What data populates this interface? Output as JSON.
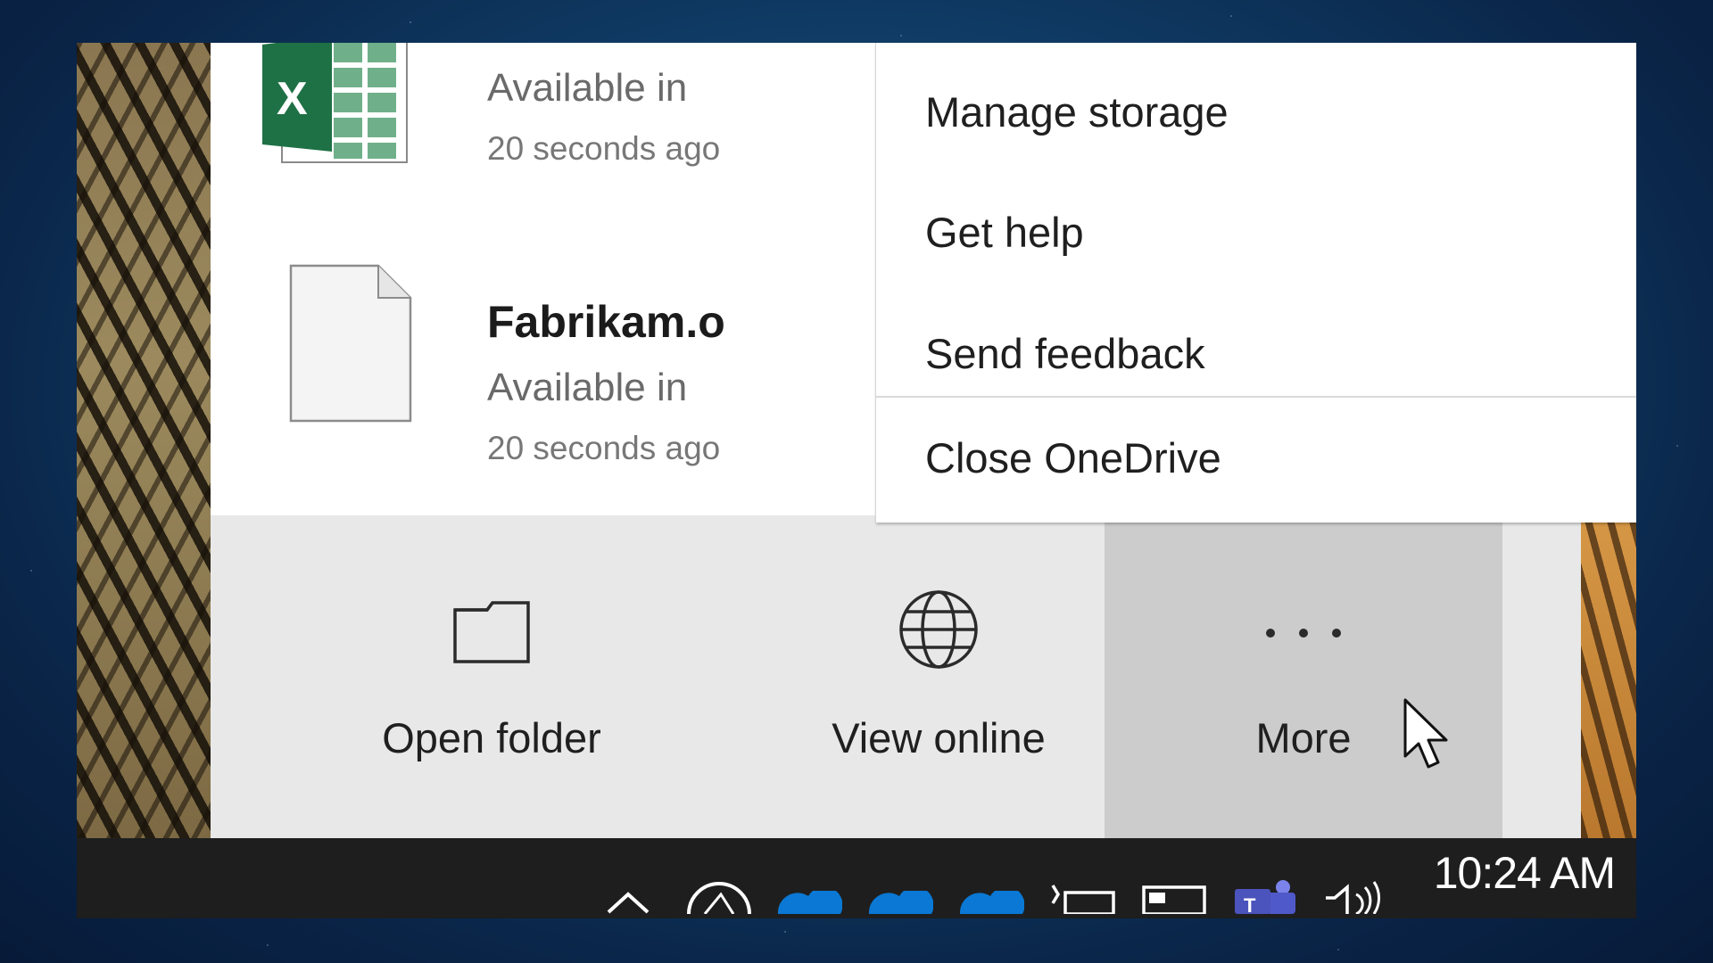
{
  "files": [
    {
      "name": "",
      "status": "Available in",
      "time": "20 seconds ago",
      "icon": "excel-icon"
    },
    {
      "name": "Fabrikam.o",
      "status": "Available in",
      "time": "20 seconds ago",
      "icon": "document-icon"
    }
  ],
  "menu": {
    "items": [
      {
        "label": "Manage storage"
      },
      {
        "label": "Get help"
      },
      {
        "label": "Send feedback"
      },
      {
        "label": "Close OneDrive"
      }
    ]
  },
  "actions": [
    {
      "label": "Open folder",
      "icon": "folder-icon"
    },
    {
      "label": "View online",
      "icon": "globe-icon"
    },
    {
      "label": "More",
      "icon": "more-icon"
    }
  ],
  "taskbar": {
    "clock": "10:24 AM",
    "tray_icons": [
      "chevron-up-icon",
      "network-status-icon",
      "onedrive-cloud-icon",
      "onedrive-cloud-icon",
      "onedrive-cloud-icon",
      "power-icon",
      "display-icon",
      "teams-icon",
      "volume-icon"
    ]
  },
  "colors": {
    "excel_green": "#1e7145",
    "hover_gray": "#cccccc",
    "bar_gray": "#e8e8e8",
    "cloud_blue": "#0a78d4"
  }
}
